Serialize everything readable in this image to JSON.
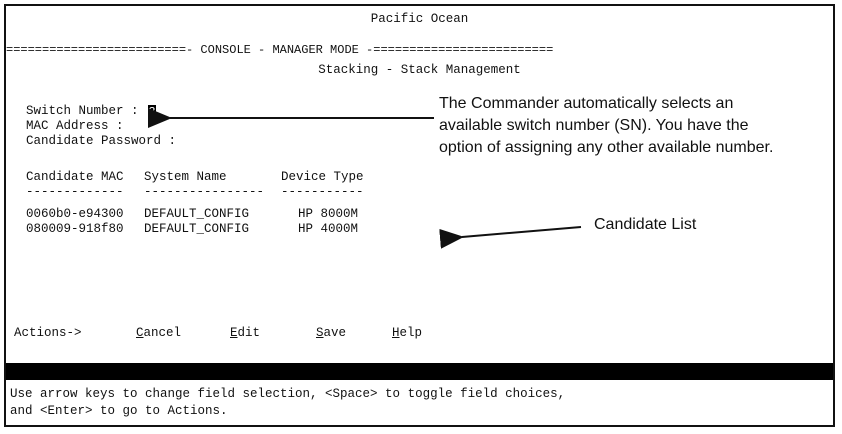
{
  "console": {
    "title": "Pacific Ocean",
    "mode_bar": "=========================- CONSOLE - MANAGER MODE -=========================",
    "screen_title": "Stacking - Stack Management"
  },
  "fields": {
    "switch_number_label": "Switch Number :",
    "switch_number_value": "3",
    "mac_address_label": "MAC Address :",
    "candidate_password_label": "Candidate Password :"
  },
  "table": {
    "headers": [
      "Candidate MAC",
      "System Name",
      "Device Type"
    ],
    "dividers": [
      "-------------",
      "----------------",
      "-----------"
    ],
    "rows": [
      [
        "0060b0-e94300",
        "DEFAULT_CONFIG",
        "HP 8000M"
      ],
      [
        "080009-918f80",
        "DEFAULT_CONFIG",
        "HP 4000M"
      ]
    ]
  },
  "actions": {
    "label": "Actions->",
    "items": [
      {
        "key": "C",
        "rest": "ancel"
      },
      {
        "key": "E",
        "rest": "dit"
      },
      {
        "key": "S",
        "rest": "ave"
      },
      {
        "key": "H",
        "rest": "elp"
      }
    ]
  },
  "help_text": {
    "line1": "Use arrow keys to change field selection, <Space> to toggle field choices,",
    "line2": "and <Enter> to go to Actions."
  },
  "annotations": {
    "switch_number_note": [
      "The Commander automatically selects an",
      "available switch number (SN). You have the",
      "option of assigning any other available number."
    ],
    "candidate_list_note": "Candidate List"
  }
}
